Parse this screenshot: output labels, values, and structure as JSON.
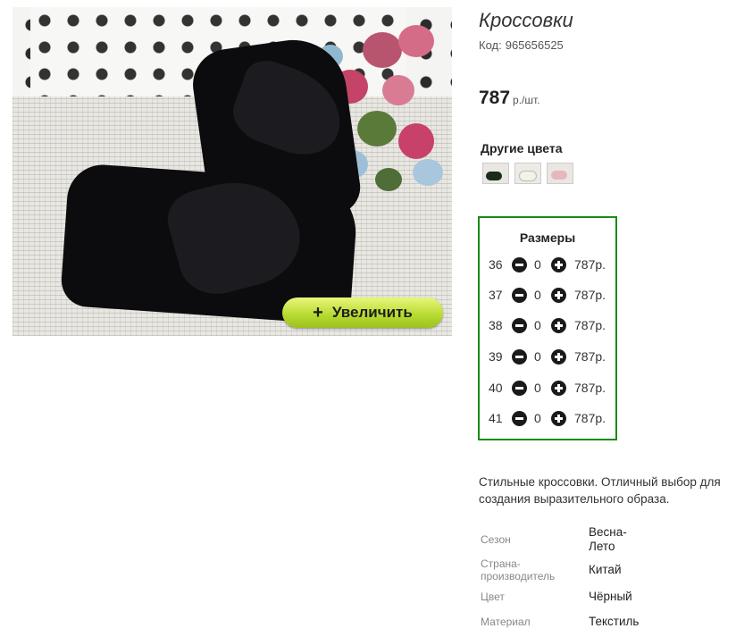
{
  "product": {
    "title": "Кроссовки",
    "code_label": "Код:",
    "code_value": "965656525",
    "price": "787",
    "price_unit": "р./шт."
  },
  "photo": {
    "zoom_label": "Увеличить",
    "zoom_icon": "+"
  },
  "colors": {
    "title": "Другие цвета",
    "swatches": [
      "black",
      "white",
      "pink"
    ]
  },
  "sizes": {
    "title": "Размеры",
    "rows": [
      {
        "size": "36",
        "qty": "0",
        "price": "787р."
      },
      {
        "size": "37",
        "qty": "0",
        "price": "787р."
      },
      {
        "size": "38",
        "qty": "0",
        "price": "787р."
      },
      {
        "size": "39",
        "qty": "0",
        "price": "787р."
      },
      {
        "size": "40",
        "qty": "0",
        "price": "787р."
      },
      {
        "size": "41",
        "qty": "0",
        "price": "787р."
      }
    ]
  },
  "description": "Стильные кроссовки. Отличный выбор для создания выразительного образа.",
  "specs": [
    {
      "label": "Сезон",
      "value": "Весна-Лето"
    },
    {
      "label": "Страна-производитель",
      "value": "Китай"
    },
    {
      "label": "Цвет",
      "value": "Чёрный"
    },
    {
      "label": "Материал",
      "value": "Текстиль"
    }
  ],
  "colors_accent": {
    "sizes_border": "#1a8a1a",
    "zoom_button": "#b5d92f"
  }
}
